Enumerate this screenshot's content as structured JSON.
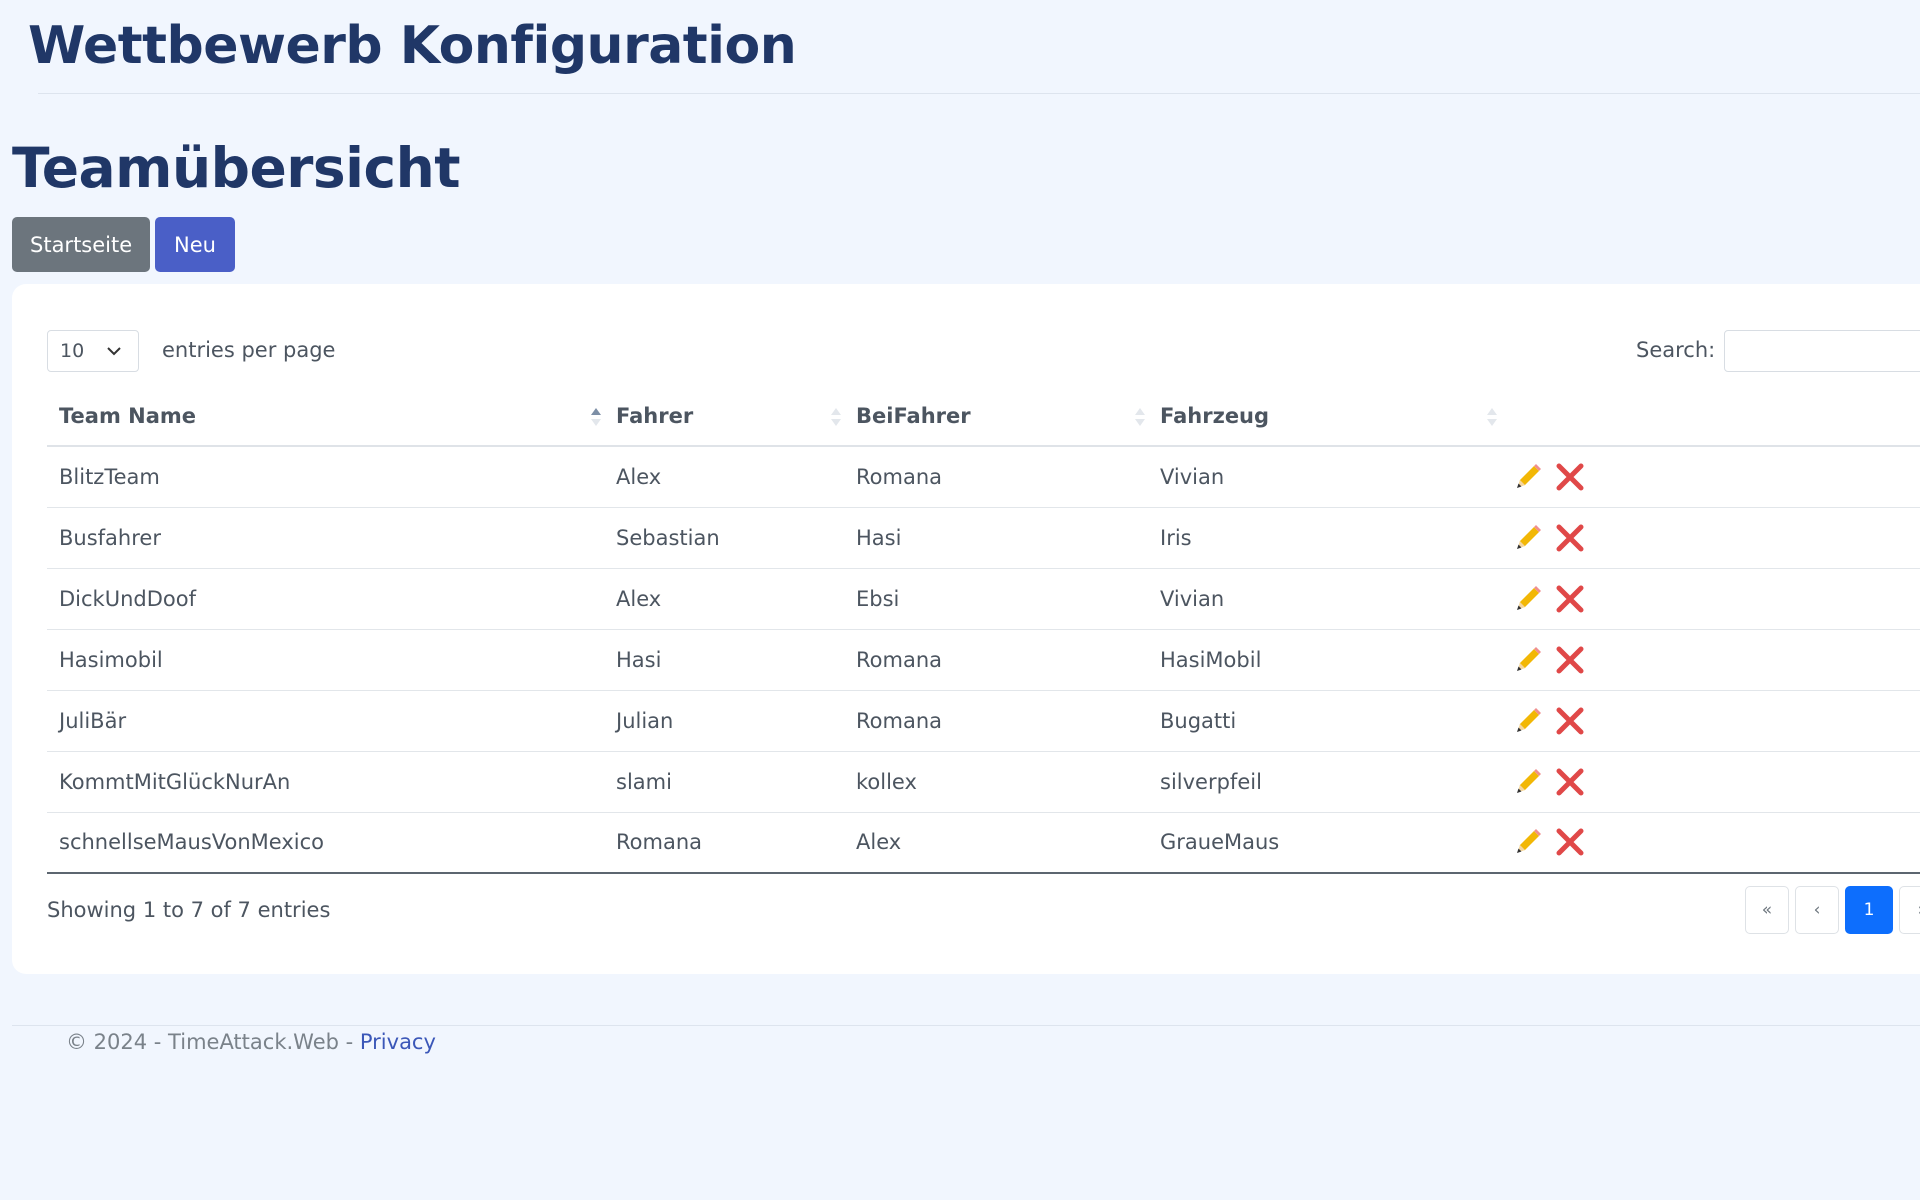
{
  "header": {
    "app_title": "Wettbewerb Konfiguration"
  },
  "page": {
    "title": "Teamübersicht",
    "buttons": {
      "home": "Startseite",
      "new": "Neu"
    }
  },
  "table_controls": {
    "page_length": "10",
    "page_length_label": "entries per page",
    "search_label": "Search:",
    "search_value": ""
  },
  "table": {
    "columns": [
      "Team Name",
      "Fahrer",
      "BeiFahrer",
      "Fahrzeug"
    ],
    "rows": [
      [
        "BlitzTeam",
        "Alex",
        "Romana",
        "Vivian"
      ],
      [
        "Busfahrer",
        "Sebastian",
        "Hasi",
        "Iris"
      ],
      [
        "DickUndDoof",
        "Alex",
        "Ebsi",
        "Vivian"
      ],
      [
        "Hasimobil",
        "Hasi",
        "Romana",
        "HasiMobil"
      ],
      [
        "JuliBär",
        "Julian",
        "Romana",
        "Bugatti"
      ],
      [
        "KommtMitGlückNurAn",
        "slami",
        "kollex",
        "silverpfeil"
      ],
      [
        "schnellseMausVonMexico",
        "Romana",
        "Alex",
        "GraueMaus"
      ]
    ],
    "row_actions": [
      "edit-icon",
      "delete-icon"
    ],
    "sorted_column": "Team Name",
    "sort_direction": "ascending"
  },
  "table_footer": {
    "info": "Showing 1 to 7 of 7 entries",
    "pagination": {
      "first": "«",
      "prev": "‹",
      "current": "1",
      "next": "›"
    }
  },
  "footer": {
    "copyright": "© 2024 - TimeAttack.Web - ",
    "privacy_link": "Privacy"
  },
  "colors": {
    "page_bg": "#f1f6fe",
    "title": "#203767",
    "btn_secondary": "#6c757d",
    "btn_primary": "#4a5fc7",
    "page_active": "#0d6efd",
    "edit_icon": "#f2b705",
    "delete_icon": "#e04848",
    "link": "#3b57b8"
  }
}
